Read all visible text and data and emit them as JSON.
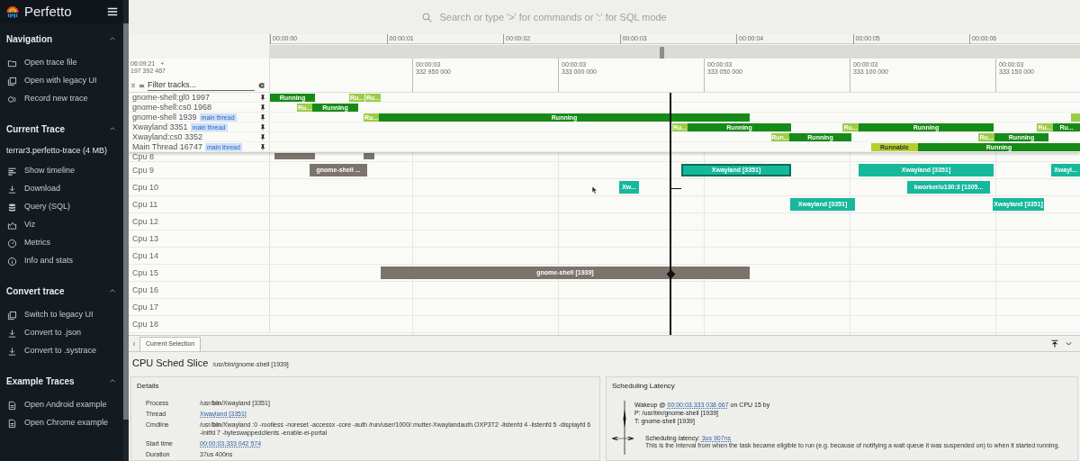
{
  "sidebar": {
    "app_name": "Perfetto",
    "sections": [
      {
        "title": "Navigation",
        "expanded": true,
        "items": [
          {
            "label": "Open trace file",
            "kind": "folder"
          },
          {
            "label": "Open with legacy UI",
            "kind": "copy"
          },
          {
            "label": "Record new trace",
            "kind": "record"
          }
        ]
      },
      {
        "title": "Current Trace",
        "expanded": true,
        "subtitle": "terrar3.perfetto-trace (4 MB)",
        "items": [
          {
            "label": "Show timeline",
            "kind": "timeline"
          },
          {
            "label": "Download",
            "kind": "download"
          },
          {
            "label": "Query (SQL)",
            "kind": "database"
          },
          {
            "label": "Viz",
            "kind": "chart"
          },
          {
            "label": "Metrics",
            "kind": "gauge"
          },
          {
            "label": "Info and stats",
            "kind": "info"
          }
        ]
      },
      {
        "title": "Convert trace",
        "expanded": true,
        "items": [
          {
            "label": "Switch to legacy UI",
            "kind": "copy"
          },
          {
            "label": "Convert to .json",
            "kind": "download"
          },
          {
            "label": "Convert to .systrace",
            "kind": "download"
          }
        ]
      },
      {
        "title": "Example Traces",
        "expanded": true,
        "items": [
          {
            "label": "Open Android example",
            "kind": "document"
          },
          {
            "label": "Open Chrome example",
            "kind": "document"
          }
        ]
      }
    ]
  },
  "search": {
    "placeholder": "Search or type '>' for commands or ':' for SQL mode"
  },
  "overview": {
    "ticks": [
      "00:00:00",
      "00:00:01",
      "00:00:02",
      "00:00:03",
      "00:00:04",
      "00:00:05",
      "00:00:06"
    ]
  },
  "time_axis": {
    "origin_time": "06:09:21",
    "origin_sign": "+",
    "origin_ns": "197 392 467",
    "ticks": [
      {
        "time": "00:00:03",
        "ns": "332 950 000"
      },
      {
        "time": "00:00:03",
        "ns": "333 000 000"
      },
      {
        "time": "00:00:03",
        "ns": "333 050 000"
      },
      {
        "time": "00:00:03",
        "ns": "333 100 000"
      },
      {
        "time": "00:00:03",
        "ns": "333 150 000"
      }
    ]
  },
  "filter": {
    "placeholder": "Filter tracks..."
  },
  "pinned_tracks": [
    {
      "name": "gnome-shell:gl0 1997",
      "pinned": true,
      "slices": [
        {
          "kind": "running",
          "label": "Running"
        },
        {
          "kind": "runnable",
          "label": "Ru..."
        },
        {
          "kind": "runnable",
          "label": "Ru..."
        }
      ]
    },
    {
      "name": "gnome-shell:cs0 1968",
      "pinned": true,
      "slices": [
        {
          "kind": "runnable",
          "label": "Ru..."
        },
        {
          "kind": "running",
          "label": "Running"
        }
      ]
    },
    {
      "name": "gnome-shell 1939",
      "tag": "main thread",
      "pinned": true,
      "slices": [
        {
          "kind": "runnable",
          "label": "Ru..."
        },
        {
          "kind": "running",
          "label": "Running"
        },
        {
          "kind": "runnable"
        }
      ]
    },
    {
      "name": "Xwayland 3351",
      "tag": "main thread",
      "pinned": true,
      "slices": [
        {
          "kind": "runnable",
          "label": "Ru..."
        },
        {
          "kind": "running",
          "label": "Running"
        },
        {
          "kind": "runnable",
          "label": "Ru..."
        },
        {
          "kind": "running",
          "label": "Running"
        },
        {
          "kind": "runnable",
          "label": "Ru..."
        },
        {
          "kind": "running",
          "label": "Ru..."
        }
      ]
    },
    {
      "name": "Xwayland:cs0 3352",
      "pinned": true,
      "slices": [
        {
          "kind": "runnable",
          "label": "Run..."
        },
        {
          "kind": "running",
          "label": "Running"
        },
        {
          "kind": "runnable",
          "label": "Ru..."
        },
        {
          "kind": "running",
          "label": "Running"
        }
      ]
    },
    {
      "name": "Main Thread 16747",
      "tag": "main thread",
      "pinned": true,
      "slices": [
        {
          "kind": "waiting",
          "label": "Runnable"
        },
        {
          "kind": "running",
          "label": "Running"
        }
      ]
    }
  ],
  "cpu_tracks": [
    {
      "name": "Cpu 8",
      "slices": [
        {
          "color": "#7d736c",
          "selected": false
        },
        {
          "color": "#7d736c",
          "selected": false
        }
      ]
    },
    {
      "name": "Cpu 9",
      "slices": [
        {
          "color": "#7d736c",
          "selected": false,
          "label": "gnome-shell ..."
        },
        {
          "color": "#16b89b",
          "selected": true,
          "label": "Xwayland [3351]"
        },
        {
          "color": "#16b89b",
          "selected": false,
          "label": "Xwayland [3351]"
        },
        {
          "color": "#16b89b",
          "selected": false,
          "label": "Xwayl..."
        }
      ]
    },
    {
      "name": "Cpu 10",
      "slices": [
        {
          "color": "#16b89b",
          "selected": false,
          "label": "Xw..."
        },
        {
          "color": "#16b89b",
          "selected": false,
          "label": "kworker/u130:3 [1305..."
        }
      ]
    },
    {
      "name": "Cpu 11",
      "slices": [
        {
          "color": "#16b89b",
          "selected": false,
          "label": "Xwayland [3351]"
        },
        {
          "color": "#16b89b",
          "selected": false,
          "label": "Xwayland [3351]"
        }
      ]
    },
    {
      "name": "Cpu 12"
    },
    {
      "name": "Cpu 13"
    },
    {
      "name": "Cpu 14"
    },
    {
      "name": "Cpu 15",
      "slices": [
        {
          "color": "#7d736c",
          "selected": false,
          "label": "gnome-shell [1939]"
        }
      ]
    },
    {
      "name": "Cpu 16"
    },
    {
      "name": "Cpu 17"
    },
    {
      "name": "Cpu 18"
    }
  ],
  "bottom_panel": {
    "tabs": [
      {
        "label": "Current Selection",
        "selected": true
      }
    ],
    "title": "CPU Sched Slice",
    "subtitle": "/usr/bin/gnome-shell [1939]",
    "details": {
      "title": "Details",
      "rows": [
        {
          "label": "Process",
          "kind": "text",
          "value": "/usr/**bin**/Xwayland [3351]"
        },
        {
          "label": "Thread",
          "kind": "link",
          "value": "Xwayland [3351]"
        },
        {
          "label": "Cmdline",
          "kind": "text",
          "value": "/usr/**bin**/Xwayland :0 -rootless -noreset -accessx -core -auth /run/user/1000/.mutter-Xwaylandauth.OXP3T2 -listenfd 4 -listenfd 5 -displayfd 6 -initfd 7 -byteswappedclients -enable-ei-portal"
        },
        {
          "label": "Start time",
          "kind": "link",
          "value": "00:00:03.333 042 574"
        },
        {
          "label": "Duration",
          "kind": "text",
          "value": "37us 400ns"
        }
      ]
    },
    "latency": {
      "title": "Scheduling Latency",
      "wakeup_prefix": "Wakeup @",
      "wakeup_time": "00:00:03.333 038 667",
      "wakeup_suffix": "on CPU 15 by",
      "process": "P: /usr/bin/gnome-shell [1939]",
      "thread": "T: gnome-shell [1939]",
      "latency_label": "Scheduling latency:",
      "latency_value": "3us 907ns",
      "description": "This is the interval from when the task became eligible to run (e.g. because of notifying a wait queue it was suspended on) to when it started running."
    }
  }
}
